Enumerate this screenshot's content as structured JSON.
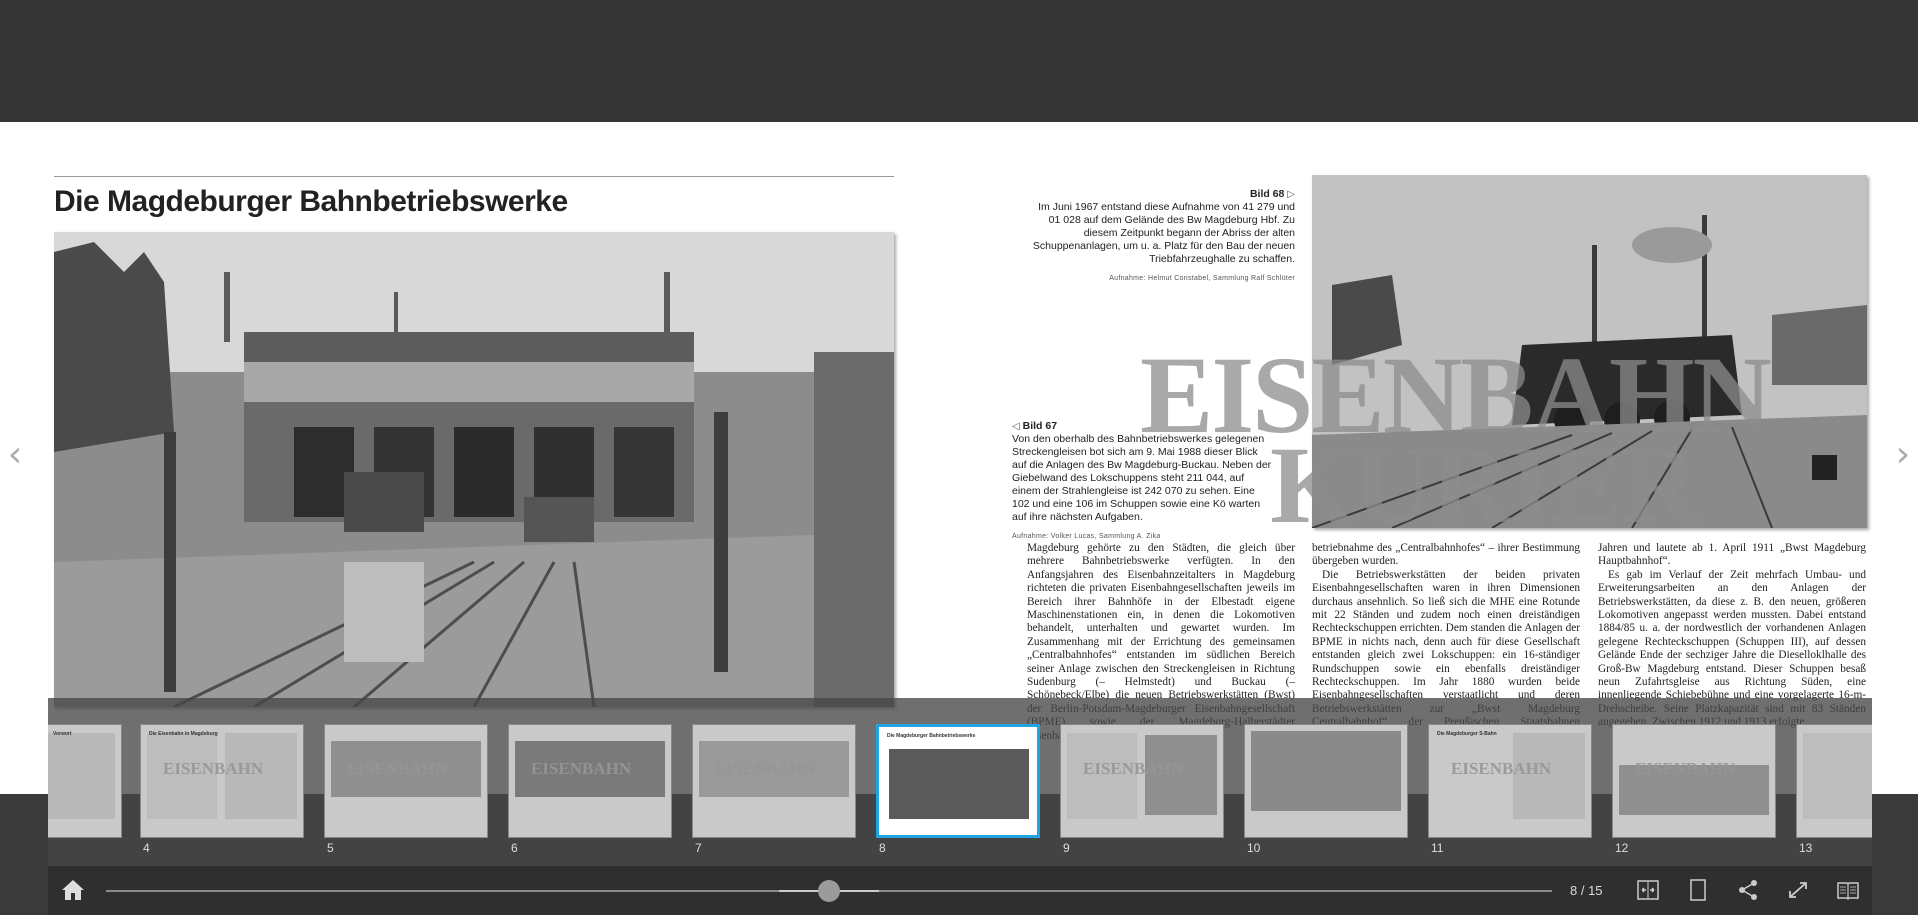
{
  "page": {
    "heading": "Die Magdeburger Bahnbetriebswerke",
    "watermark_line1": "EISENBAHN",
    "watermark_line2": "KURIER"
  },
  "captions": {
    "bild68": {
      "title": "Bild 68",
      "text": "Im Juni 1967 entstand diese Aufnahme von 41 279 und 01 028 auf dem Gelände des Bw Magdeburg Hbf. Zu diesem Zeitpunkt began­n der Abriss der alten Schuppenanlagen, um u. a. Platz für den Bau der neuen Triebfahrzeughalle zu schaffen.",
      "credit": "Aufnahme: Helmut Constabel, Sammlung Ralf Schlüter"
    },
    "bild67": {
      "title": "Bild 67",
      "text": "Von den oberhalb des Bahnbetriebswerkes gelegenen Streckengleisen bot sich am 9. Mai 1988 dieser Blick auf die Anlagen des Bw Magdeburg-Buckau. Neben der Giebelwand des Lokschuppens steht 211 044, auf einem der Strahlengleise ist 242 070 zu sehen. Eine 102 und eine 106 im Schuppen sowie eine Kö warten auf ihre nächsten Aufgaben.",
      "credit": "Aufnahme: Volker Lucas, Sammlung A. Zika"
    }
  },
  "body_text": {
    "col1": "Magdeburg gehörte zu den Städten, die gleich über mehrere Bahnbetriebswerke verfügten. In den Anfangsjahren des Eisenbahnzeitalters in Magdeburg richteten die privaten Eisenbahngesellschaften jeweils im Bereich ihrer Bahnhöfe in der Elbestadt eigene Maschinenstationen ein, in denen die Lokomotiven behandelt, unterhalten und gewartet wurden. Im Zusammenhang mit der Errichtung des gemeinsamen „Centralbahnhofes“ entstanden im südlichen Bereich seiner Anlage zwischen den Streckengleisen in Richtung Sudenburg (– Helmstedt) und Buckau (– Schönebeck/Elbe) die neuen Betriebswerkstätten (Bwst) der Berlin-Potsdam-Magdeburger Eisenbahngesellschaft (BPME) sowie der Magdeburg-Halberstädter Eisenbahngesellschaft (MHE)",
    "col2a": "betriebnahme des „Centralbahnhofes“ – ihrer Bestimmung übergeben wurden.",
    "col2b": "Die Betriebswerkstätten der beiden privaten Eisenbahngesellschaften waren in ihren Dimensionen durchaus ansehnlich. So ließ sich die MHE eine Rotunde mit 22 Ständen und zudem noch einen dreiständigen Rechteckschuppen errichten. Dem standen die Anlagen der BPME in nichts nach, denn auch für diese Gesellschaft entstanden gleich zwei Lokschuppen: ein 16-ständiger Rundschuppen sowie ein ebenfalls dreiständiger Rechteckschuppen. Im Jahr 1880 wurden beide Eisenbahngesellschaften verstaatlicht und deren Betriebswerkstätten zur „Bwst Magdeburg Centralbahnhof“ der Preußischen Staatsbahnen zusammengefasst",
    "col3a": "Jahren und lautete ab 1. April 1911 „Bwst Magdeburg Hauptbahnhof“.",
    "col3b": "Es gab im Verlauf der Zeit mehrfach Umbau- und Erweiterungsarbeiten an den Anlagen der Betriebswerkstätten, da diese z. B. den neuen, größeren Lokomotiven angepasst werden mussten. Dabei entstand 1884/85 u. a. der nordwestlich der vorhandenen Anlagen gelegene Rechteckschuppen (Schuppen III), auf dessen Gelände Ende der sechziger Jahre die Dieselloklhalle des Groß-Bw Magdeburg entstand. Dieser Schuppen besaß neun Zufahrtsgleise aus Richtung Süden, eine innenliegende Schiebebühne und eine vorgelagerte 16-m-Drehscheibe. Seine Platzkapazität sind mit 83 Ständen angegeben. Zwischen 1912 und 1913 erfolgte"
  },
  "thumbnails": [
    {
      "num": "",
      "title": "Vorwort"
    },
    {
      "num": "4",
      "title": "Die Eisenbahn in Magdeburg"
    },
    {
      "num": "5",
      "title": ""
    },
    {
      "num": "6",
      "title": ""
    },
    {
      "num": "7",
      "title": ""
    },
    {
      "num": "8",
      "title": "Die Magdeburger Bahnbetriebswerke"
    },
    {
      "num": "9",
      "title": ""
    },
    {
      "num": "10",
      "title": ""
    },
    {
      "num": "11",
      "title": "Die Magdeburger S-Bahn"
    },
    {
      "num": "12",
      "title": ""
    },
    {
      "num": "13",
      "title": ""
    }
  ],
  "thumb_watermark": "EISENBAHN",
  "toolbar": {
    "page_counter": "8 / 15",
    "progress": 0.5,
    "icons": [
      "home-icon",
      "fit-width-icon",
      "single-page-icon",
      "share-icon",
      "fullscreen-icon",
      "book-icon"
    ]
  },
  "nav": {
    "prev": "‹",
    "next": "›"
  },
  "colors": {
    "active_thumb_border": "#21a3e0",
    "toolbar_bg": "#2f2f2f",
    "background": "#3a3a3a"
  }
}
